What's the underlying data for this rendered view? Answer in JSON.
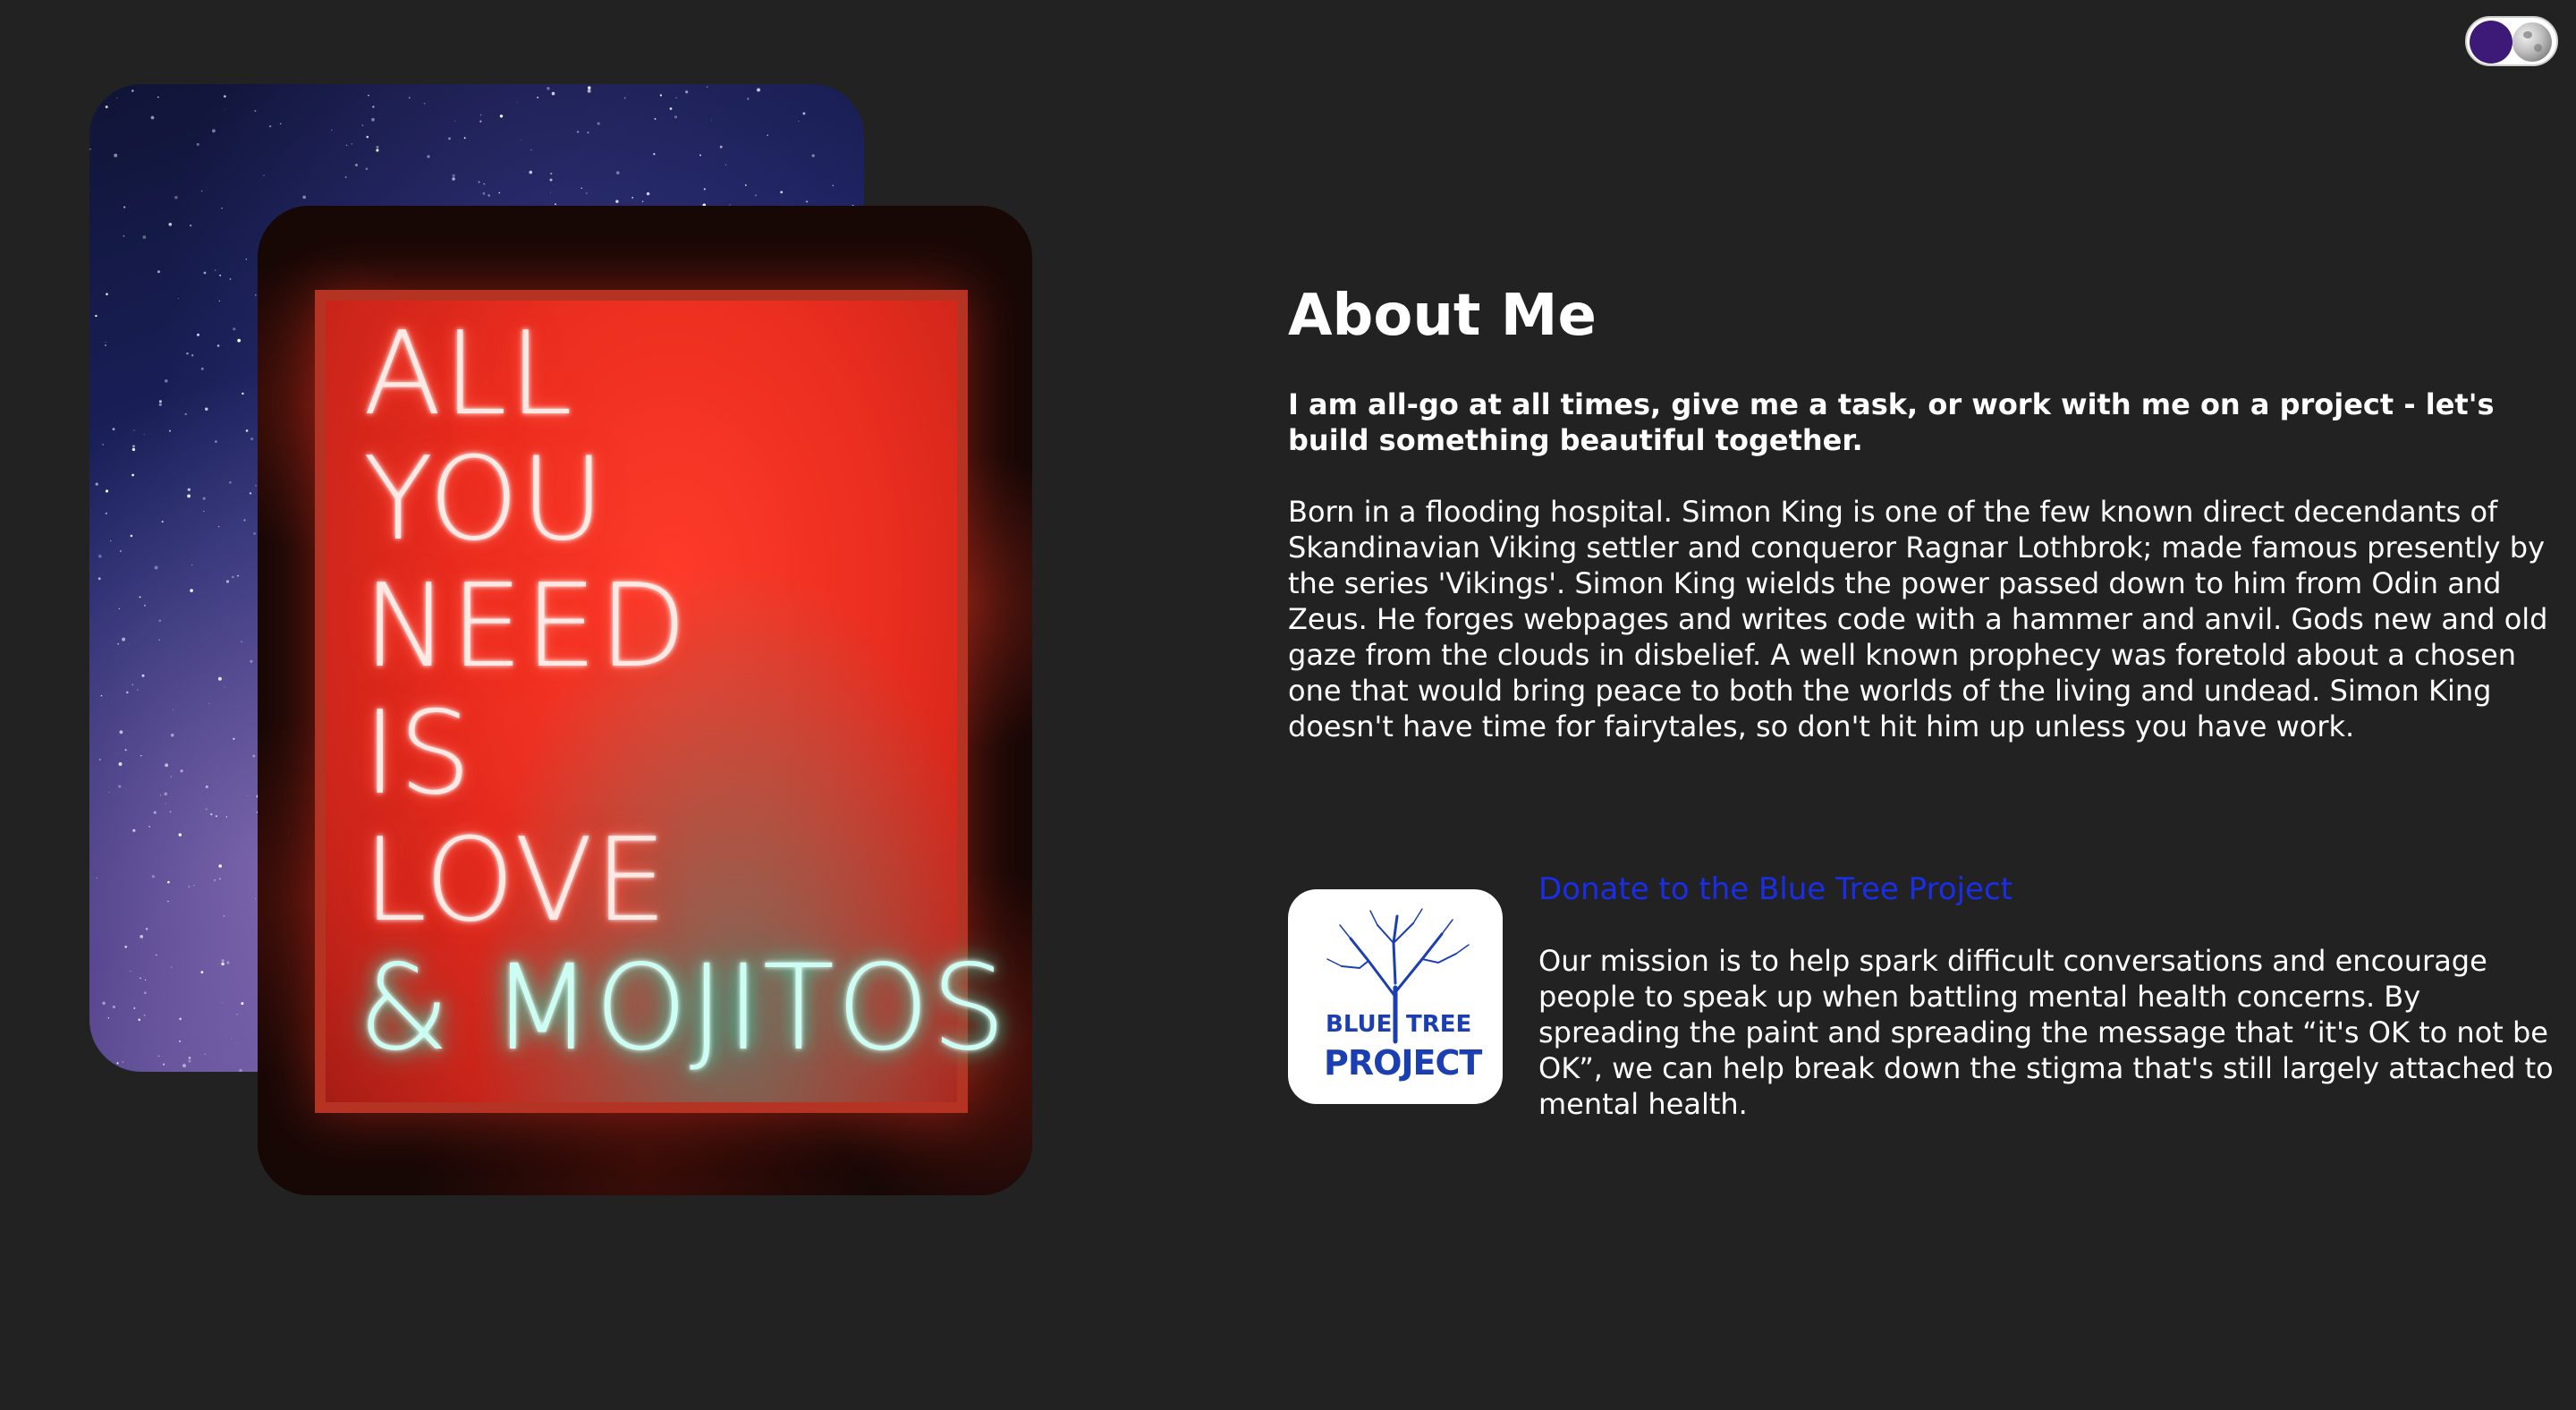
{
  "theme_toggle": {
    "icon_on": "moon-icon",
    "knob_color": "#3d1a78"
  },
  "images": {
    "back": {
      "description_icon": "starry-sky-image"
    },
    "front": {
      "description_icon": "neon-sign-image",
      "neon_lines": [
        "ALL",
        "YOU",
        "NEED",
        "IS",
        "LOVE",
        "& MOJITOS"
      ],
      "neon_red": "#ff3322",
      "neon_teal": "#3ef0c8"
    }
  },
  "about": {
    "title": "About Me",
    "lead": "I am all-go at all times, give me a task, or work with me on a project - let's build something beautiful together.",
    "bio": "Born in a flooding hospital. Simon King is one of the few known direct decendants of Skandinavian Viking settler and conqueror Ragnar Lothbrok; made famous presently by the series 'Vikings'. Simon King wields the power passed down to him from Odin and Zeus. He forges webpages and writes code with a hammer and anvil. Gods new and old gaze from the clouds in disbelief. A well known prophecy was foretold about a chosen one that would bring peace to both the worlds of the living and undead. Simon King doesn't have time for fairytales, so don't hit him up unless you have work."
  },
  "donation": {
    "link_text": "Donate to the Blue Tree Project",
    "link_color": "#1a2ee8",
    "logo": {
      "line1_left": "BLUE",
      "line1_right": "TREE",
      "line2": "PROJECT",
      "color": "#1b3fb0"
    },
    "mission": "Our mission is to help spark difficult conversations and encourage people to speak up when battling mental health concerns. By spreading the paint and spreading the message that “it's OK to not be OK”, we can help break down the stigma that's still largely attached to mental health."
  }
}
